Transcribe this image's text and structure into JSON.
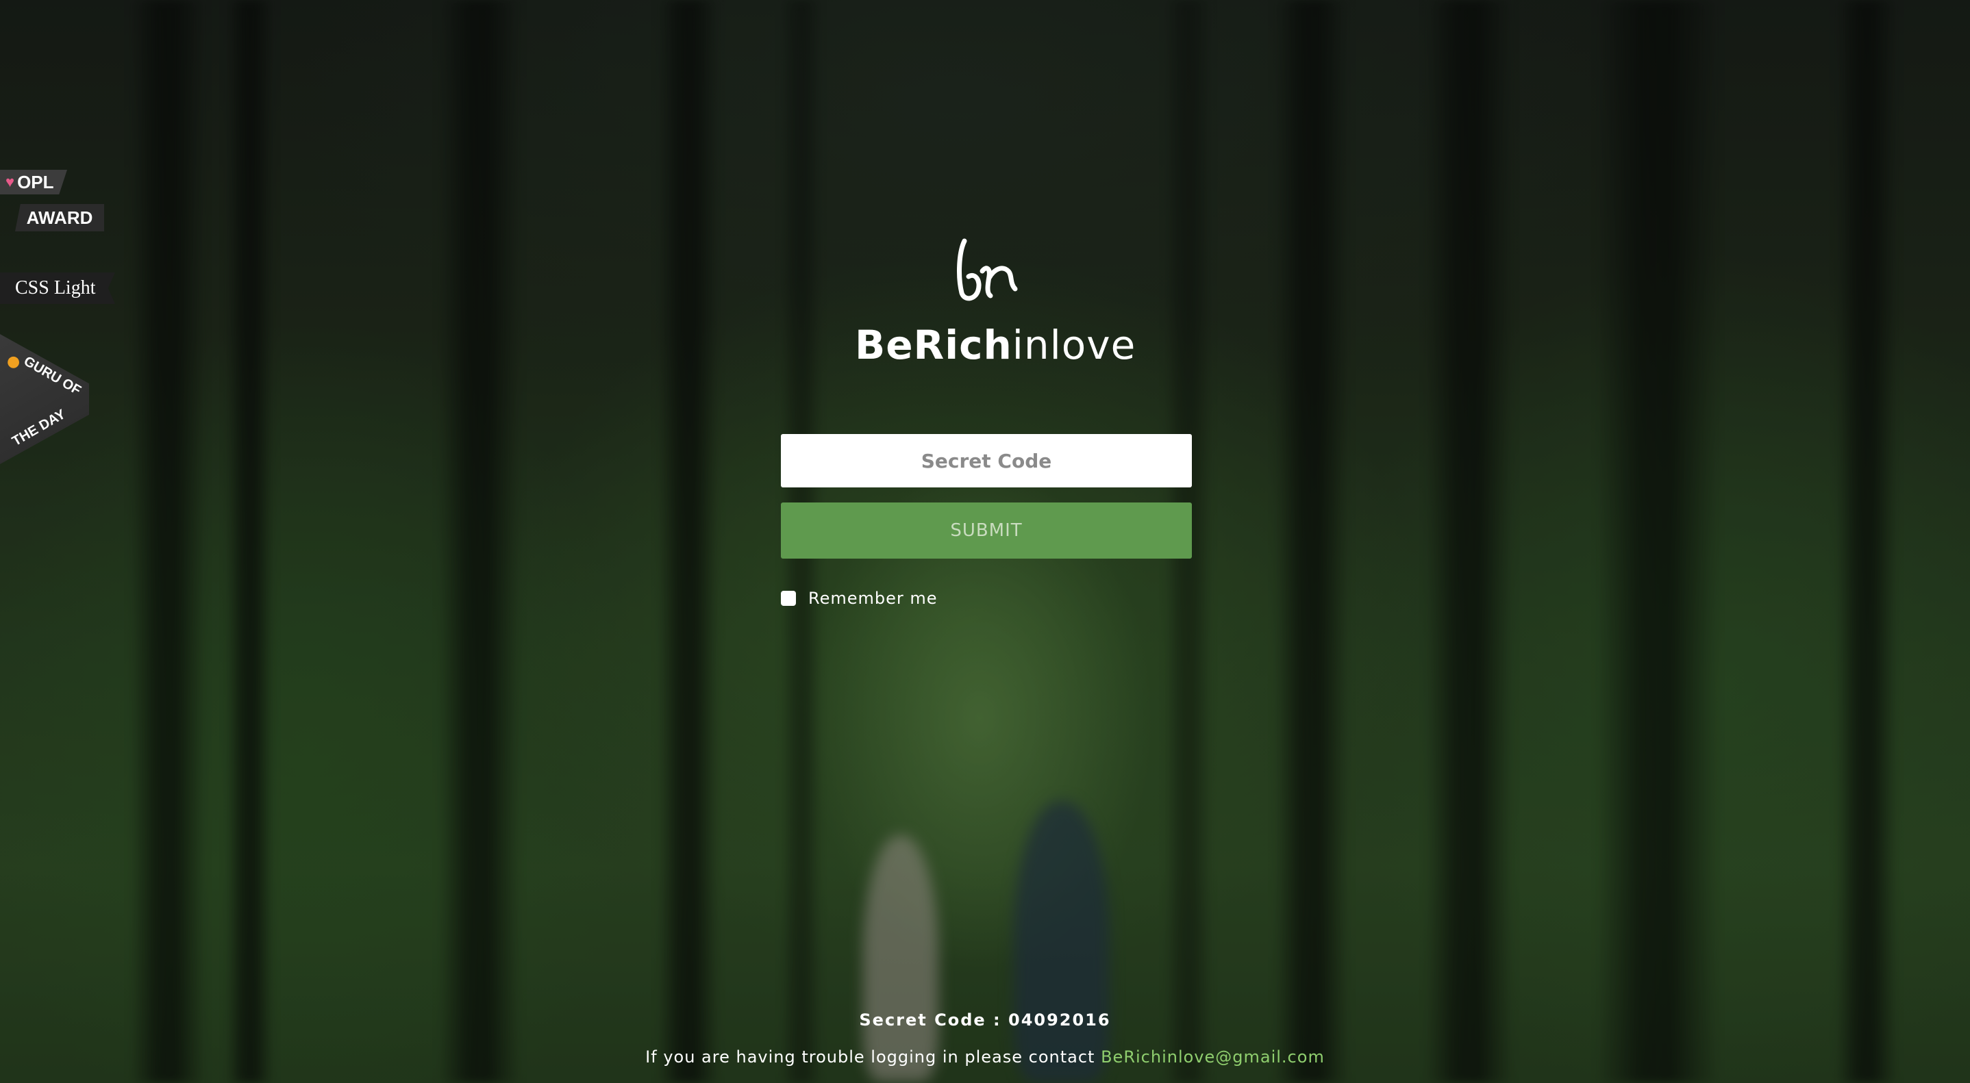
{
  "badges": {
    "opl_label": "OPL",
    "award_label": "AWARD",
    "css_light_label": "CSS Light",
    "guru_top_label": "GURU OF",
    "guru_bottom_label": "THE DAY"
  },
  "brand": {
    "logo_icon": "br-monogram-icon",
    "name_bold": "BeRich",
    "name_light": "inlove"
  },
  "form": {
    "code_placeholder": "Secret Code",
    "code_value": "",
    "submit_label": "SUBMIT",
    "remember_label": "Remember me",
    "remember_checked": false
  },
  "footer": {
    "secret_code_text": "Secret Code : 04092016",
    "contact_prefix": "If you are having trouble logging in please contact ",
    "contact_email": "BeRichinlove@gmail.com"
  },
  "colors": {
    "accent": "#5f9a4e",
    "link": "#8fce6e"
  }
}
